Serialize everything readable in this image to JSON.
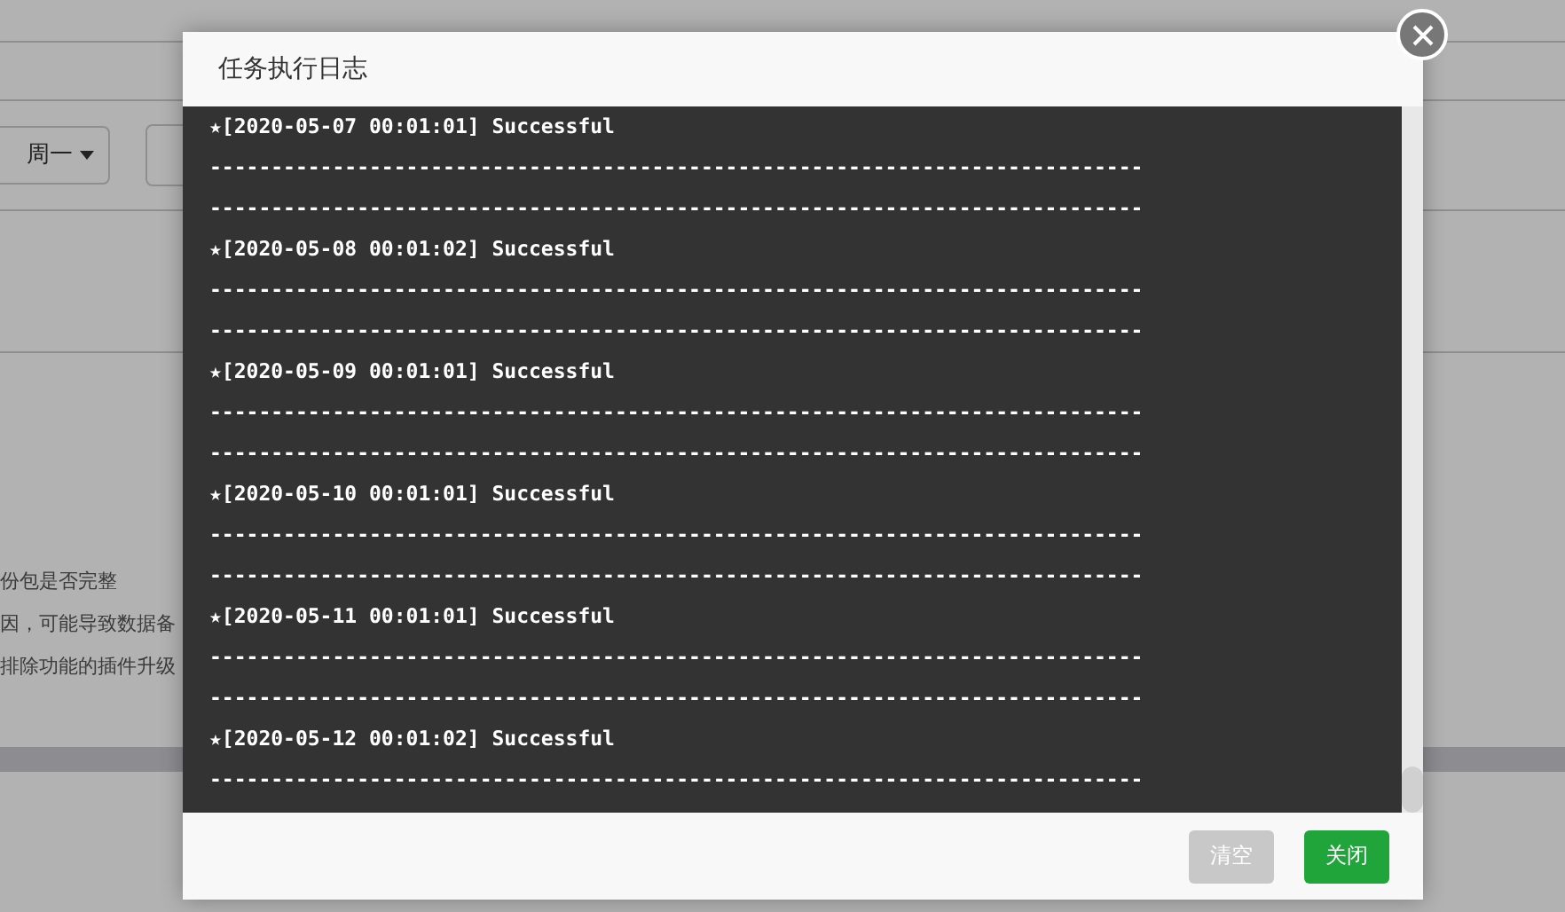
{
  "background": {
    "select_value": "周一",
    "notes": [
      "份包是否完整",
      "因，可能导致数据备",
      "排除功能的插件升级"
    ]
  },
  "dialog": {
    "title": "任务执行日志",
    "log_lines": [
      "★[2020-05-07 00:01:01] Successful",
      "----------------------------------------------------------------------------",
      "----------------------------------------------------------------------------",
      "★[2020-05-08 00:01:02] Successful",
      "----------------------------------------------------------------------------",
      "----------------------------------------------------------------------------",
      "★[2020-05-09 00:01:01] Successful",
      "----------------------------------------------------------------------------",
      "----------------------------------------------------------------------------",
      "★[2020-05-10 00:01:01] Successful",
      "----------------------------------------------------------------------------",
      "----------------------------------------------------------------------------",
      "★[2020-05-11 00:01:01] Successful",
      "----------------------------------------------------------------------------",
      "----------------------------------------------------------------------------",
      "★[2020-05-12 00:01:02] Successful",
      "----------------------------------------------------------------------------"
    ],
    "buttons": [
      {
        "label": "清空",
        "kind": "secondary"
      },
      {
        "label": "关闭",
        "kind": "primary"
      }
    ]
  }
}
